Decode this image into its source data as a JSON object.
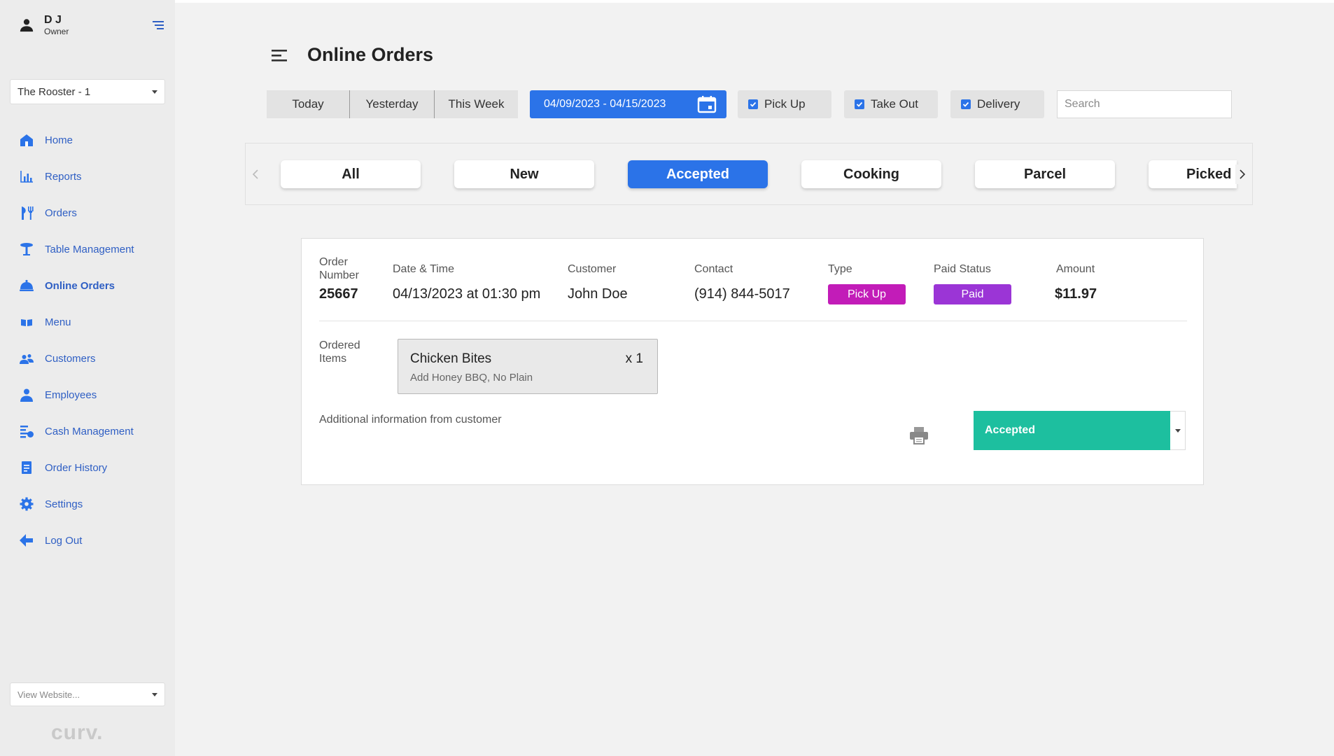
{
  "user": {
    "name": "D J",
    "role": "Owner"
  },
  "store_selector": {
    "value": "The Rooster - 1"
  },
  "nav": [
    {
      "label": "Home",
      "icon": "home-icon"
    },
    {
      "label": "Reports",
      "icon": "bar-chart-icon"
    },
    {
      "label": "Orders",
      "icon": "utensils-icon"
    },
    {
      "label": "Table Management",
      "icon": "table-icon"
    },
    {
      "label": "Online Orders",
      "icon": "cloche-icon",
      "active": true
    },
    {
      "label": "Menu",
      "icon": "menu-book-icon"
    },
    {
      "label": "Customers",
      "icon": "users-icon"
    },
    {
      "label": "Employees",
      "icon": "person-icon"
    },
    {
      "label": "Cash Management",
      "icon": "cash-icon"
    },
    {
      "label": "Order History",
      "icon": "document-icon"
    },
    {
      "label": "Settings",
      "icon": "gear-icon"
    },
    {
      "label": "Log Out",
      "icon": "arrow-left-icon"
    }
  ],
  "view_website": {
    "placeholder": "View Website..."
  },
  "brand": {
    "logo_text": "curv."
  },
  "header": {
    "title": "Online Orders"
  },
  "ranges": [
    "Today",
    "Yesterday",
    "This Week"
  ],
  "date_range": "04/09/2023 - 04/15/2023",
  "filters": [
    {
      "label": "Pick Up",
      "checked": true
    },
    {
      "label": "Take Out",
      "checked": true
    },
    {
      "label": "Delivery",
      "checked": true
    }
  ],
  "search": {
    "placeholder": "Search"
  },
  "tabs": [
    {
      "label": "All",
      "active": false
    },
    {
      "label": "New",
      "active": false
    },
    {
      "label": "Accepted",
      "active": true
    },
    {
      "label": "Cooking",
      "active": false
    },
    {
      "label": "Parcel",
      "active": false
    },
    {
      "label": "Picked Up",
      "active": false
    }
  ],
  "order": {
    "labels": {
      "number": "Order Number",
      "datetime": "Date & Time",
      "customer": "Customer",
      "contact": "Contact",
      "type": "Type",
      "paid_status": "Paid Status",
      "amount": "Amount",
      "ordered_items": "Ordered Items",
      "additional": "Additional information from customer"
    },
    "number": "25667",
    "datetime": "04/13/2023 at 01:30 pm",
    "customer": "John Doe",
    "contact": "(914) 844-5017",
    "type": "Pick Up",
    "paid_status": "Paid",
    "amount": "$11.97",
    "items": [
      {
        "name": "Chicken Bites",
        "qty": "x 1",
        "modifiers": "Add Honey BBQ, No Plain"
      }
    ],
    "status": "Accepted"
  },
  "colors": {
    "accent": "#2b73e8",
    "type_badge": "#c21cb8",
    "paid_badge": "#9b35d6",
    "status": "#1dbf9f",
    "nav_text": "#2f5fc4"
  }
}
